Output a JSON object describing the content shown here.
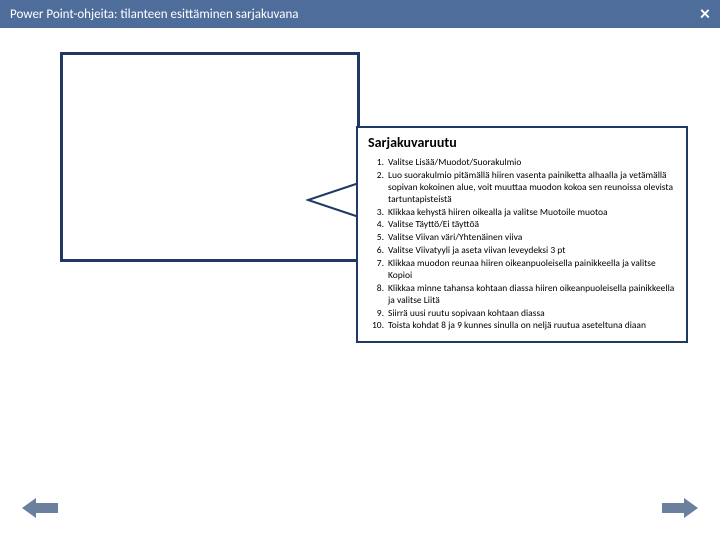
{
  "header": {
    "title": "Power Point-ohjeita: tilanteen esittäminen sarjakuvana",
    "close": "×"
  },
  "callout": {
    "heading": "Sarjakuvaruutu",
    "items": [
      {
        "n": "1.",
        "t": "Valitse Lisää/Muodot/Suorakulmio"
      },
      {
        "n": "2.",
        "t": "Luo suorakulmio pitämällä hiiren vasenta painiketta alhaalla ja vetämällä sopivan kokoinen alue, voit muuttaa muodon kokoa sen reunoissa olevista tartuntapisteistä"
      },
      {
        "n": "3.",
        "t": "Klikkaa kehystä hiiren oikealla ja valitse Muotoile muotoa"
      },
      {
        "n": "4.",
        "t": "Valitse Täyttö/Ei täyttöä"
      },
      {
        "n": "5.",
        "t": "Valitse Viivan väri/Yhtenäinen viiva"
      },
      {
        "n": "6.",
        "t": "Valitse Viivatyyli ja aseta viivan leveydeksi 3 pt"
      },
      {
        "n": "7.",
        "t": "Klikkaa muodon reunaa hiiren oikeanpuoleisella painikkeella ja valitse Kopioi"
      },
      {
        "n": "8.",
        "t": "Klikkaa minne tahansa kohtaan diassa hiiren oikeanpuoleisella painikkeella ja valitse Liitä"
      },
      {
        "n": "9.",
        "t": "Siirrä uusi ruutu sopivaan kohtaan diassa"
      },
      {
        "n": "10.",
        "t": "Toista kohdat 8 ja 9 kunnes sinulla on neljä ruutua aseteltuna diaan"
      }
    ]
  }
}
